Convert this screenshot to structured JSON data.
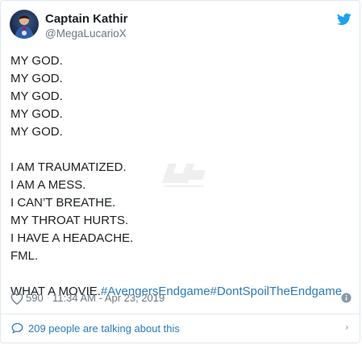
{
  "author": {
    "display_name": "Captain Kathir",
    "handle": "@MegaLucarioX"
  },
  "tweet": {
    "lines_block1": [
      "MY GOD.",
      "MY GOD.",
      "MY GOD.",
      "MY GOD.",
      "MY GOD."
    ],
    "lines_block2": [
      "I AM TRAUMATIZED.",
      "I AM A MESS.",
      "I CAN’T BREATHE.",
      "MY THROAT HURTS.",
      "I HAVE A HEADACHE.",
      "FML."
    ],
    "final_text": "WHAT A MOVIE.",
    "hashtags": [
      "#AvengersEndgame",
      "#DontSpoilTheEndgame"
    ]
  },
  "footer": {
    "like_count": "590",
    "timestamp": "11:34 AM - Apr 23, 2019",
    "talking_text": "209 people are talking about this"
  },
  "icons": {
    "brand": "twitter-bird-icon",
    "like": "heart-icon",
    "info": "info-icon",
    "talk": "speech-bubble-icon"
  },
  "colors": {
    "brand_blue": "#1da1f2",
    "link_blue": "#2b7bb9",
    "text": "#1c2022",
    "muted": "#697882",
    "border": "#e1e8ed"
  }
}
